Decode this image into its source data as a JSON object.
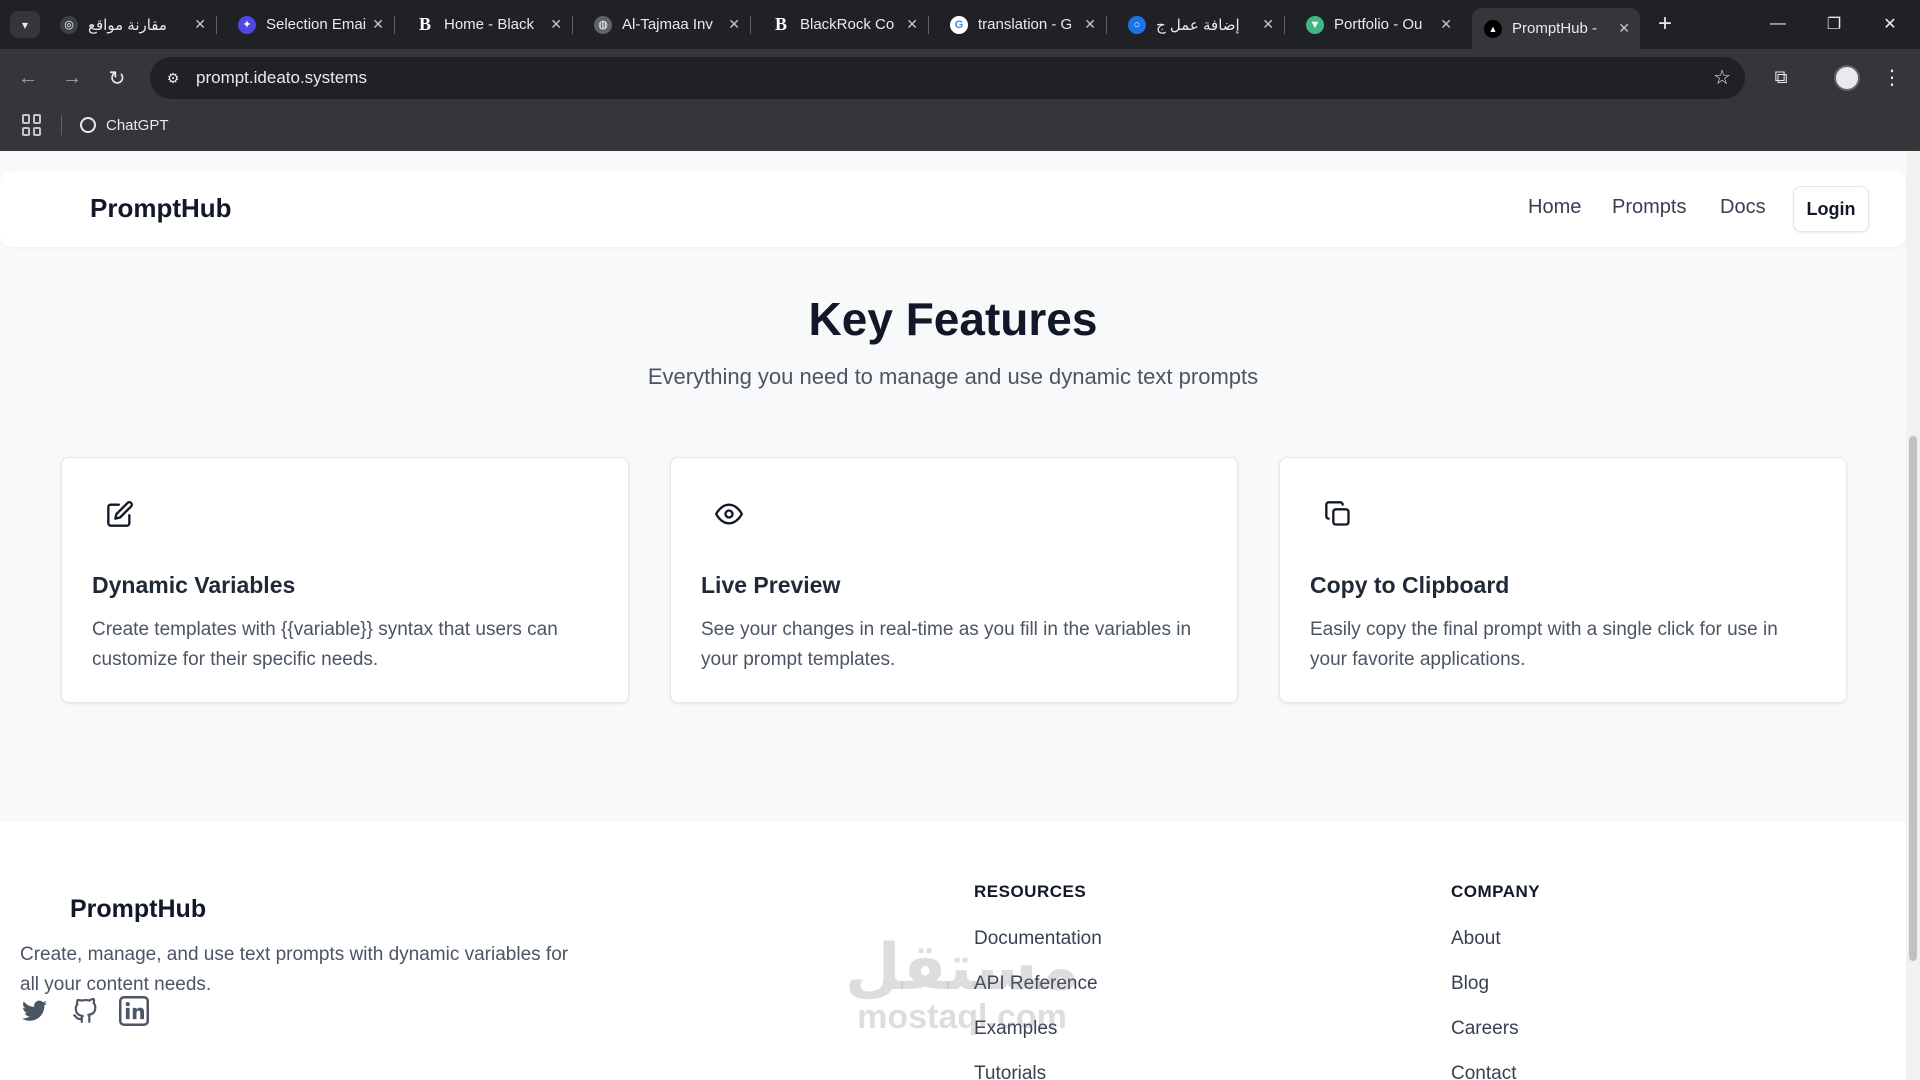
{
  "browser": {
    "tabs": [
      {
        "label": "مقارنة مواقع",
        "favicon": "chatgpt-icon",
        "fav_color": "#3c4043",
        "active": false
      },
      {
        "label": "Selection Email",
        "favicon": "app-icon",
        "fav_color": "#4f46e5",
        "active": false
      },
      {
        "label": "Home - Black",
        "favicon": "b-letter-icon",
        "fav_color": "#202124",
        "active": false
      },
      {
        "label": "Al-Tajmaa Inv",
        "favicon": "globe-icon",
        "fav_color": "#5f6368",
        "active": false
      },
      {
        "label": "BlackRock Co",
        "favicon": "b-letter-icon",
        "fav_color": "#202124",
        "active": false
      },
      {
        "label": "translation - G",
        "favicon": "google-icon",
        "fav_color": "#ffffff",
        "active": false
      },
      {
        "label": "إضافة عمل ج",
        "favicon": "circle-icon",
        "fav_color": "#1a73e8",
        "active": false
      },
      {
        "label": "Portfolio - Ou",
        "favicon": "vue-icon",
        "fav_color": "#41b883",
        "active": false
      },
      {
        "label": "PromptHub -",
        "favicon": "triangle-icon",
        "fav_color": "#000000",
        "active": true
      }
    ],
    "url": "prompt.ideato.systems",
    "bookmarks": [
      {
        "label": "ChatGPT",
        "icon": "chatgpt-icon"
      }
    ]
  },
  "header": {
    "brand": "PromptHub",
    "nav": [
      "Home",
      "Prompts",
      "Docs"
    ],
    "login_label": "Login"
  },
  "features": {
    "title": "Key Features",
    "subtitle": "Everything you need to manage and use dynamic text prompts",
    "cards": [
      {
        "icon": "edit-icon",
        "title": "Dynamic Variables",
        "description": "Create templates with {{variable}} syntax that users can customize for their specific needs."
      },
      {
        "icon": "eye-icon",
        "title": "Live Preview",
        "description": "See your changes in real-time as you fill in the variables in your prompt templates."
      },
      {
        "icon": "copy-icon",
        "title": "Copy to Clipboard",
        "description": "Easily copy the final prompt with a single click for use in your favorite applications."
      }
    ]
  },
  "footer": {
    "brand": "PromptHub",
    "description": "Create, manage, and use text prompts with dynamic variables for all your content needs.",
    "social": [
      "twitter-icon",
      "github-icon",
      "linkedin-icon"
    ],
    "resources": {
      "heading": "RESOURCES",
      "links": [
        "Documentation",
        "API Reference",
        "Examples",
        "Tutorials"
      ]
    },
    "company": {
      "heading": "COMPANY",
      "links": [
        "About",
        "Blog",
        "Careers",
        "Contact"
      ]
    }
  },
  "watermark": {
    "arabic": "مستقل",
    "latin": "mostaql.com"
  },
  "colors": {
    "text_dark": "#111827",
    "text_muted": "#4b5563",
    "page_bg": "#f8f9fa",
    "chrome_bg": "#35363a"
  }
}
